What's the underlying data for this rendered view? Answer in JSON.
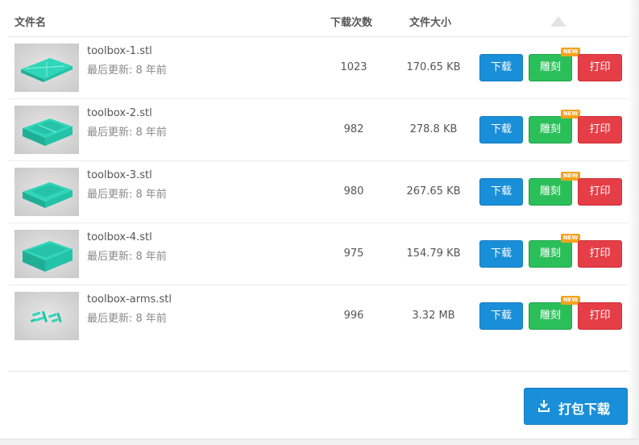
{
  "table": {
    "headers": {
      "name": "文件名",
      "count": "下载次数",
      "size": "文件大小"
    },
    "rows": [
      {
        "name": "toolbox-1.stl",
        "updated_label": "最后更新:",
        "updated_value": "8 年前",
        "downloads": "1023",
        "size": "170.65 KB"
      },
      {
        "name": "toolbox-2.stl",
        "updated_label": "最后更新:",
        "updated_value": "8 年前",
        "downloads": "982",
        "size": "278.8 KB"
      },
      {
        "name": "toolbox-3.stl",
        "updated_label": "最后更新:",
        "updated_value": "8 年前",
        "downloads": "980",
        "size": "267.65 KB"
      },
      {
        "name": "toolbox-4.stl",
        "updated_label": "最后更新:",
        "updated_value": "8 年前",
        "downloads": "975",
        "size": "154.79 KB"
      },
      {
        "name": "toolbox-arms.stl",
        "updated_label": "最后更新:",
        "updated_value": "8 年前",
        "downloads": "996",
        "size": "3.32 MB"
      }
    ]
  },
  "actions": {
    "download_label": "下载",
    "engrave_label": "雕刻",
    "print_label": "打印",
    "new_badge": "NEW"
  },
  "footer": {
    "pack_download_label": "打包下载"
  },
  "colors": {
    "download": "#1a8fd9",
    "engrave": "#2bbf5a",
    "print": "#e53e47",
    "badge": "#f5a21c",
    "model": "#2fd6b9"
  },
  "icons": {
    "sort": "triangle-up-icon",
    "pack": "download-tray-icon"
  }
}
